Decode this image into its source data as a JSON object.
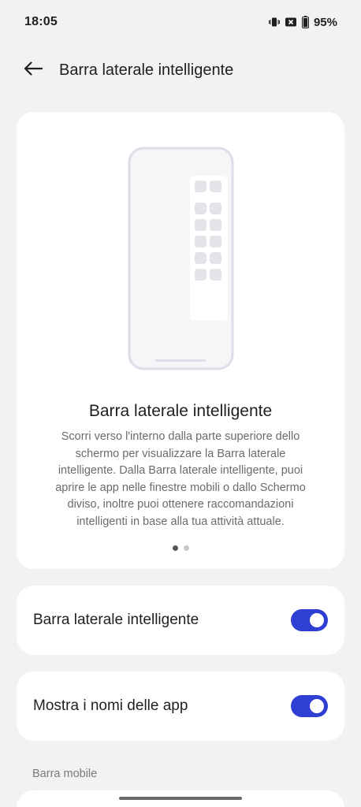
{
  "status_bar": {
    "time": "18:05",
    "battery": "95%",
    "icons": [
      "vibrate-icon",
      "no-sim-icon",
      "battery-icon"
    ]
  },
  "app_bar": {
    "title": "Barra laterale intelligente",
    "back_icon": "arrow-left-icon"
  },
  "intro": {
    "title": "Barra laterale intelligente",
    "description": "Scorri verso l'interno dalla parte superiore dello schermo per visualizzare la Barra laterale intelligente. Dalla Barra laterale intelligente, puoi aprire le app nelle finestre mobili o dallo Schermo diviso, inoltre puoi ottenere raccomandazioni intelligenti in base alla tua attività attuale.",
    "page_count": 2,
    "current_page": 1
  },
  "settings": [
    {
      "label": "Barra laterale intelligente",
      "enabled": true
    },
    {
      "label": "Mostra i nomi delle app",
      "enabled": true
    }
  ],
  "section_header": "Barra mobile",
  "colors": {
    "background": "#f2f2f4",
    "card": "#ffffff",
    "accent": "#2f3fd4",
    "secondary_text": "#6b6b6b"
  }
}
